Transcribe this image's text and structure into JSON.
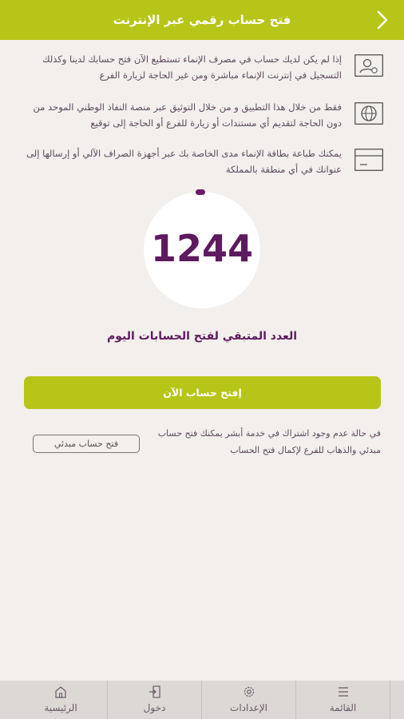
{
  "header": {
    "title": "فتح حساب رقمي عبر الإنترنت"
  },
  "info": [
    {
      "text": "إذا لم يكن لديك حساب في مصرف الإنماء تستطيع الآن فتح حسابك لدينا وكذلك التسجيل في إنترنت الإنماء مباشرة ومن غير الحاجة لزيارة الفرع",
      "icon": "user-id-icon"
    },
    {
      "text": "فقط من خلال هذا التطبيق و من خلال التوثيق عبر منصة النفاذ الوطني الموحد من دون الحاجة لتقديم أي مستندات أو زيارة للفرع أو الحاجة إلى توقيع",
      "icon": "globe-icon"
    },
    {
      "text": "يمكنك طباعة بطاقة الإنماء مدى الخاصة بك عبر أجهزة الصراف الآلي أو إرسالها إلى عنوانك في أي منطقة بالمملكة",
      "icon": "card-icon"
    }
  ],
  "counter": {
    "value": "1244",
    "label": "العدد المتبقي لفتح الحسابات اليوم"
  },
  "open_button": "إفتح حساب الآن",
  "note": {
    "text": "في حالة عدم وجود اشتراك في خدمة أبشر يمكنك فتح حساب مبدئي والذهاب للفرع لإكمال فتح الحساب",
    "button": "فتح حساب مبدئي"
  },
  "nav": {
    "menu": "القائمة",
    "settings": "الإعدادات",
    "login": "دخول",
    "home": "الرئيسية"
  },
  "colors": {
    "accent": "#b7c518",
    "primary_text": "#5e1a5e",
    "background": "#f2efec"
  }
}
